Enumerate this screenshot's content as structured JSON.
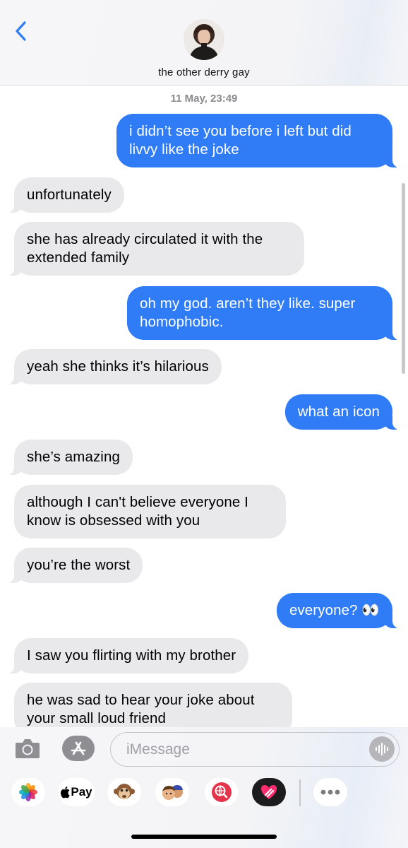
{
  "header": {
    "contact_name": "the other derry gay"
  },
  "conversation": {
    "timestamp": "11 May, 23:49",
    "messages": [
      {
        "direction": "out",
        "text": "i didn’t see you before i left but did livvy like the joke"
      },
      {
        "direction": "in",
        "text": "unfortunately"
      },
      {
        "direction": "in",
        "text": "she has already circulated it with the extended family"
      },
      {
        "direction": "out",
        "text": "oh my god. aren’t they like. super homophobic."
      },
      {
        "direction": "in",
        "text": "yeah she thinks it’s hilarious"
      },
      {
        "direction": "out",
        "text": "what an icon"
      },
      {
        "direction": "in",
        "text": "she’s amazing"
      },
      {
        "direction": "in",
        "text": "although I can't believe everyone I know is obsessed with you"
      },
      {
        "direction": "in",
        "text": "you’re the worst"
      },
      {
        "direction": "out",
        "text": "everyone? 👀"
      },
      {
        "direction": "in",
        "text": "I saw you flirting with my brother"
      },
      {
        "direction": "in",
        "text": "he was sad to hear your joke about your small loud friend"
      }
    ]
  },
  "input": {
    "placeholder": "iMessage"
  },
  "apps": {
    "items": [
      {
        "name": "photos-app-icon"
      },
      {
        "name": "apple-pay-app",
        "label": "Pay"
      },
      {
        "name": "animoji-app-icon"
      },
      {
        "name": "memoji-app-icon"
      },
      {
        "name": "images-search-app-icon"
      },
      {
        "name": "digital-touch-app-icon"
      },
      {
        "name": "more-apps-icon"
      }
    ]
  },
  "colors": {
    "outgoing_bubble": "#2f7cf6",
    "incoming_bubble": "#e9e9eb",
    "accent": "#2f7cf6"
  }
}
